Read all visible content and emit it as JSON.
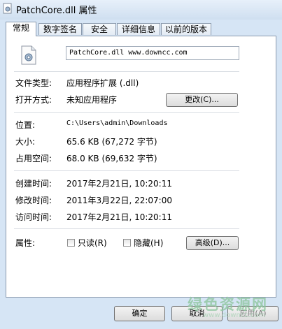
{
  "window": {
    "title": "PatchCore.dll 属性"
  },
  "tabs": [
    {
      "label": "常规",
      "active": true
    },
    {
      "label": "数字签名",
      "active": false
    },
    {
      "label": "安全",
      "active": false
    },
    {
      "label": "详细信息",
      "active": false
    },
    {
      "label": "以前的版本",
      "active": false
    }
  ],
  "general": {
    "file_name": "PatchCore.dll www.downcc.com",
    "type_label": "文件类型:",
    "type_value": "应用程序扩展 (.dll)",
    "open_label": "打开方式:",
    "open_value": "未知应用程序",
    "change_button": "更改(C)...",
    "location_label": "位置:",
    "location_value": "C:\\Users\\admin\\Downloads",
    "size_label": "大小:",
    "size_value": "65.6 KB (67,272 字节)",
    "disk_size_label": "占用空间:",
    "disk_size_value": "68.0 KB (69,632 字节)",
    "created_label": "创建时间:",
    "created_value": "2017年2月21日, 10:20:11",
    "modified_label": "修改时间:",
    "modified_value": "2011年3月22日, 22:07:00",
    "accessed_label": "访问时间:",
    "accessed_value": "2017年2月21日, 10:20:11",
    "attributes_label": "属性:",
    "readonly_label": "只读(R)",
    "hidden_label": "隐藏(H)",
    "advanced_button": "高级(D)..."
  },
  "footer": {
    "ok_button": "确定",
    "cancel_button": "取消",
    "apply_button": "应用(A)"
  },
  "watermark": {
    "text": "绿色资源网",
    "url": "www.downcc.com"
  }
}
